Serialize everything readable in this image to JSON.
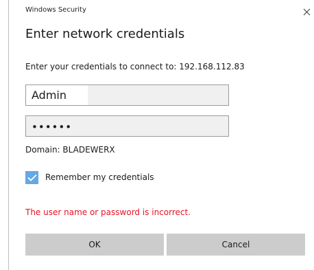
{
  "window": {
    "app_title": "Windows Security",
    "close_glyph": "×"
  },
  "dialog": {
    "heading": "Enter network credentials",
    "connect_text": "Enter your credentials to connect to: 192.168.112.83",
    "username": {
      "value": "Admin"
    },
    "password": {
      "value": "••••••"
    },
    "domain_text": "Domain: BLADEWERX",
    "remember": {
      "label": "Remember my credentials",
      "checked": true
    },
    "error_text": "The user name or password is incorrect.",
    "buttons": {
      "ok_label": "OK",
      "cancel_label": "Cancel"
    }
  },
  "colors": {
    "checkbox_accent": "#64a8e6",
    "error": "#e81123",
    "button_bg": "#cccccc"
  },
  "icons": {
    "close": "close-icon",
    "check": "checkmark-icon"
  }
}
